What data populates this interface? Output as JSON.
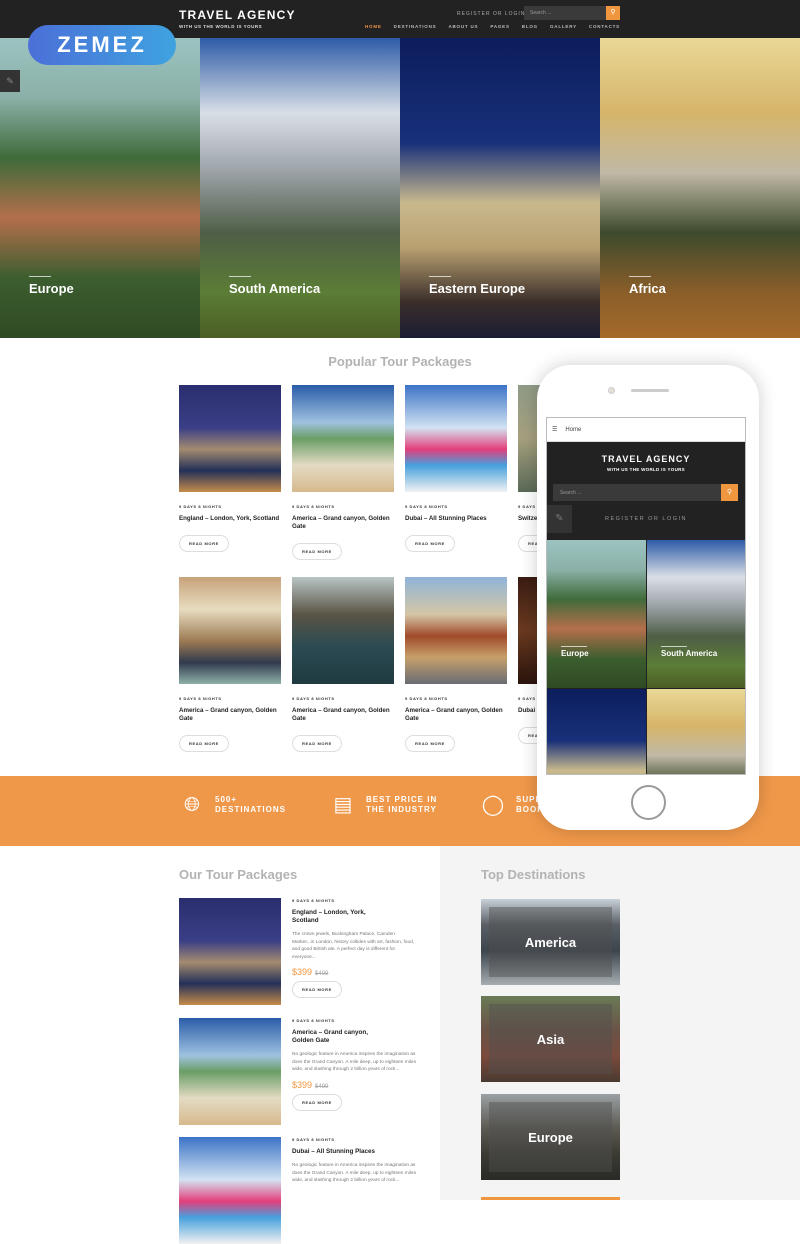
{
  "header": {
    "title": "TRAVEL AGENCY",
    "tagline": "WITH US THE WORLD IS YOURS",
    "register_login": "REGISTER OR LOGIN",
    "search_placeholder": "Search ...",
    "nav": [
      "HOME",
      "DESTINATIONS",
      "ABOUT US",
      "PAGES",
      "BLOG",
      "GALLERY",
      "CONTACTS"
    ],
    "active_nav": "HOME"
  },
  "badge": {
    "logo_text": "ZEMEZ"
  },
  "hero": {
    "tiles": [
      {
        "name": "Europe"
      },
      {
        "name": "South America"
      },
      {
        "name": "Eastern Europe"
      },
      {
        "name": "Africa"
      }
    ]
  },
  "popular": {
    "title": "Popular Tour Packages",
    "cards": [
      {
        "meta": "9 DAYS 8 NIGHTS",
        "title": "England – London, York, Scotland",
        "button": "READ MORE"
      },
      {
        "meta": "9 DAYS 8 NIGHTS",
        "title": "America – Grand canyon, Golden Gate",
        "button": "READ MORE"
      },
      {
        "meta": "9 DAYS 8 NIGHTS",
        "title": "Dubai – All Stunning Places",
        "button": "READ MORE"
      },
      {
        "meta": "9 DAYS",
        "title": "Switze Zerma",
        "button": "REA"
      },
      {
        "meta": "9 DAYS 8 NIGHTS",
        "title": "America – Grand canyon, Golden Gate",
        "button": "READ MORE"
      },
      {
        "meta": "9 DAYS 8 NIGHTS",
        "title": "America – Grand canyon, Golden Gate",
        "button": "READ MORE"
      },
      {
        "meta": "9 DAYS 8 NIGHTS",
        "title": "America – Grand canyon, Golden Gate",
        "button": "READ MORE"
      },
      {
        "meta": "9 DAYS",
        "title": "Dubai",
        "button": "REA"
      }
    ]
  },
  "features": [
    {
      "icon": "globe-icon",
      "text": "500+ DESTINATIONS"
    },
    {
      "icon": "price-tag-icon",
      "text": "BEST PRICE IN THE INDUSTRY"
    },
    {
      "icon": "mouse-click-icon",
      "text": "SUPE BOOK"
    }
  ],
  "tours": {
    "title": "Our Tour Packages",
    "items": [
      {
        "meta": "9 DAYS 8 NIGHTS",
        "title": "England – London, York, Scotland",
        "desc": "The crown jewels, Buckingham Palace, Camden Market...in London, history collides with art, fashion, food, and good British ale. A perfect day is different for everyone...",
        "price": "$399",
        "old_price": "$499",
        "button": "READ MORE"
      },
      {
        "meta": "9 DAYS 8 NIGHTS",
        "title": "America – Grand canyon, Golden Gate",
        "desc": "No geologic feature in America inspires the imagination as does the Grand Canyon. A mile deep, up to eighteen miles wide, and slashing through 2 billion years of rock...",
        "price": "$399",
        "old_price": "$499",
        "button": "READ MORE"
      },
      {
        "meta": "9 DAYS 8 NIGHTS",
        "title": "Dubai – All Stunning Places",
        "desc": "No geologic feature in America inspires the imagination as does the Grand Canyon. A mile deep, up to eighteen miles wide, and slashing through 2 billion years of rock..."
      }
    ]
  },
  "destinations": {
    "title": "Top Destinations",
    "items": [
      {
        "name": "America"
      },
      {
        "name": "Asia"
      },
      {
        "name": "Europe"
      }
    ]
  },
  "mobile": {
    "menu_label": "Home",
    "title": "TRAVEL AGENCY",
    "tagline": "WITH US THE WORLD IS YOURS",
    "search_placeholder": "Search ...",
    "register_login": "REGISTER OR LOGIN",
    "tiles": [
      {
        "name": "Europe"
      },
      {
        "name": "South America"
      },
      {
        "name": ""
      },
      {
        "name": ""
      }
    ]
  },
  "colors": {
    "accent": "#f0963f",
    "header_bg": "#222222",
    "band_bg": "#f0984a"
  }
}
